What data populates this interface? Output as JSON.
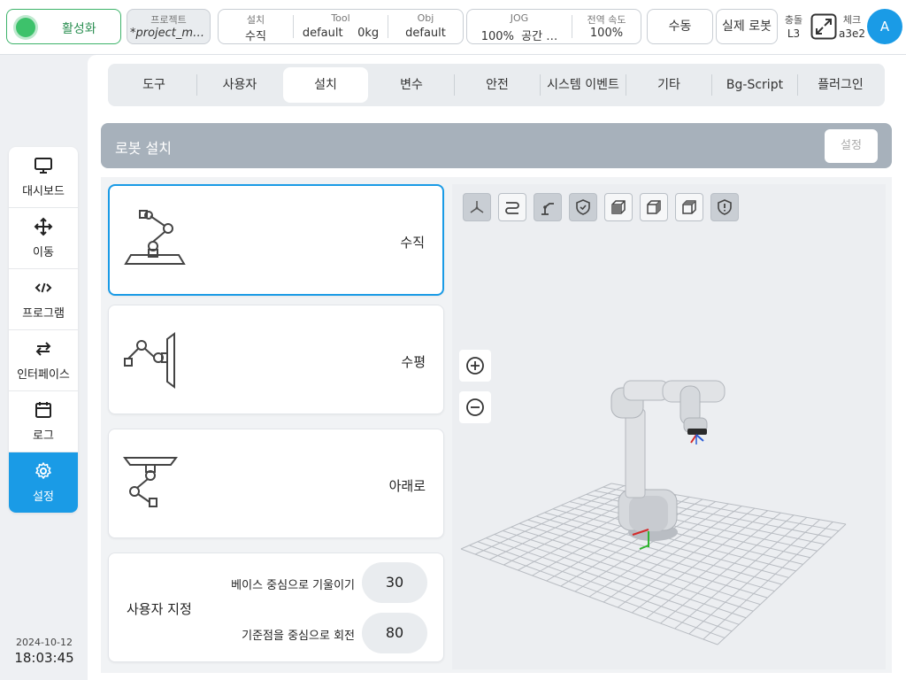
{
  "topbar": {
    "power_label": "활성화",
    "project_caption": "프로젝트",
    "project_value": "*project_mo…",
    "install_caption": "설치",
    "install_value": "수직",
    "tool_caption": "Tool",
    "tool_value": "default    0kg",
    "obj_caption": "Obj",
    "obj_value": "default",
    "jog_caption": "JOG",
    "jog_value": "100%  공간 …",
    "speed_caption": "전역 속도",
    "speed_value": "100%",
    "mode_label": "수동",
    "robot_label": "실제 로봇",
    "collision_caption": "충돌",
    "collision_value": "L3",
    "check_caption": "체크",
    "check_value": "a3e2",
    "avatar_letter": "A"
  },
  "sidebar": {
    "items": [
      {
        "label": "대시보드",
        "icon": "monitor-icon"
      },
      {
        "label": "이동",
        "icon": "move-icon"
      },
      {
        "label": "프로그램",
        "icon": "code-icon"
      },
      {
        "label": "인터페이스",
        "icon": "swap-icon"
      },
      {
        "label": "로그",
        "icon": "calendar-icon"
      },
      {
        "label": "설정",
        "icon": "gear-icon"
      }
    ],
    "active_index": 5
  },
  "datetime": {
    "date": "2024-10-12",
    "time": "18:03:45"
  },
  "tabs": [
    {
      "label": "도구"
    },
    {
      "label": "사용자"
    },
    {
      "label": "설치"
    },
    {
      "label": "변수"
    },
    {
      "label": "안전"
    },
    {
      "label": "시스템 이벤트"
    },
    {
      "label": "기타"
    },
    {
      "label": "Bg-Script"
    },
    {
      "label": "플러그인"
    }
  ],
  "active_tab": 2,
  "section": {
    "title": "로봇 설치",
    "button_label": "설정"
  },
  "mounts": [
    {
      "label": "수직",
      "selected": true
    },
    {
      "label": "수평",
      "selected": false
    },
    {
      "label": "아래로",
      "selected": false
    }
  ],
  "custom": {
    "title": "사용자 지정",
    "tilt_label": "베이스 중심으로 기울이기",
    "tilt_value": "30",
    "rotate_label": "기준점을 중심으로 회전",
    "rotate_value": "80"
  },
  "viewport": {
    "toolbar": [
      {
        "icon": "axes-icon",
        "on": true
      },
      {
        "icon": "path-icon",
        "on": false
      },
      {
        "icon": "robot-arm-icon",
        "on": true
      },
      {
        "icon": "shield-check-icon",
        "on": true
      },
      {
        "icon": "cube-front-icon",
        "on": false
      },
      {
        "icon": "cube-side-icon",
        "on": false
      },
      {
        "icon": "cube-top-icon",
        "on": false
      },
      {
        "icon": "shield-alert-icon",
        "on": true
      }
    ],
    "zoom_in_icon": "zoom-in-icon",
    "zoom_out_icon": "zoom-out-icon"
  },
  "colors": {
    "accent": "#1a9be6",
    "power_green": "#3dc26b",
    "header_gray": "#a7b1bb"
  }
}
